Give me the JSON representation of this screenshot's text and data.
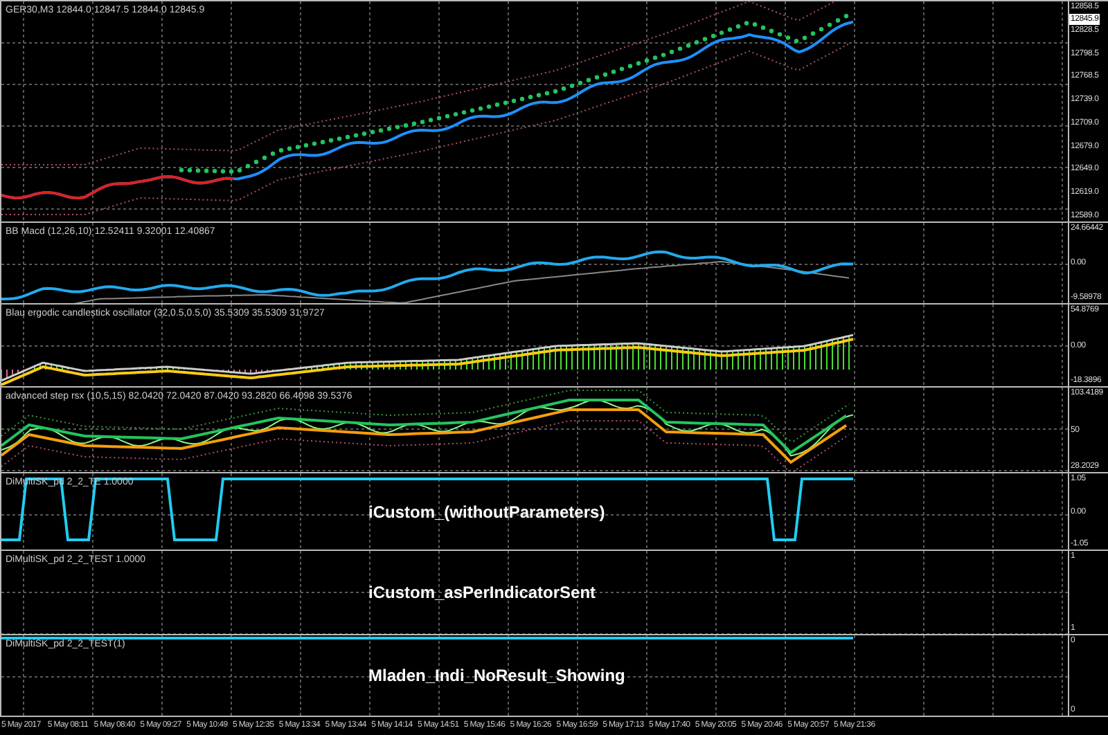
{
  "panes": [
    {
      "kind": "price",
      "title": "GER30,M3  12844.0 12847.5 12844.0 12845.9",
      "axis": [
        "12858.5",
        "12828.5",
        "12798.5",
        "12768.5",
        "12739.0",
        "12709.0",
        "12679.0",
        "12649.0",
        "12619.0",
        "12589.0"
      ],
      "current_price": "12845.9"
    },
    {
      "kind": "macd",
      "title": "BB Macd (12,26,10) 12.52411 9.32001 12.40867",
      "axis": [
        "24.66442",
        "0.00",
        "-9.58978"
      ]
    },
    {
      "kind": "blau",
      "title": "Blau ergodic candlestick oscillator (32,0.5,0.5,0) 35.5309 35.5309 31.9727",
      "axis": [
        "54.8769",
        "0.00",
        "-18.3896"
      ]
    },
    {
      "kind": "rsx",
      "title": "advanced step rsx (10,5,15) 82.0420 72.0420 87.0420 93.2820 66.4098 39.5376",
      "axis": [
        "103.4189",
        "50",
        "28.2029"
      ]
    },
    {
      "kind": "step",
      "title": "DiMultiSK_pd 2_2_TE 1.0000",
      "axis": [
        "1.05",
        "0.00",
        "-1.05"
      ],
      "overlay_text": "iCustom_(withoutParameters)"
    },
    {
      "kind": "empty",
      "title": "DiMultiSK_pd 2_2_TEST 1.0000",
      "axis": [
        "1",
        "1"
      ],
      "overlay_text": "iCustom_asPerIndicatorSent"
    },
    {
      "kind": "flat",
      "title": "DiMultiSK_pd 2_2_TEST(1)",
      "axis": [
        "0",
        "0"
      ],
      "overlay_text": "Mladen_Indi_NoResult_Showing"
    }
  ],
  "time_axis": [
    "5 May 2017",
    "5 May 08:11",
    "5 May 08:40",
    "5 May 09:27",
    "5 May 10:49",
    "5 May 12:35",
    "5 May 13:34",
    "5 May 13:44",
    "5 May 14:14",
    "5 May 14:51",
    "5 May 15:46",
    "5 May 16:26",
    "5 May 16:59",
    "5 May 17:13",
    "5 May 17:40",
    "5 May 20:05",
    "5 May 20:46",
    "5 May 20:57",
    "5 May 21:36"
  ]
}
